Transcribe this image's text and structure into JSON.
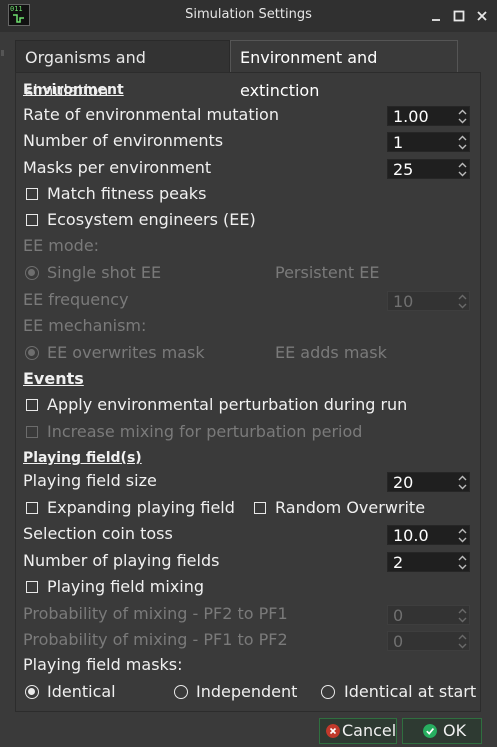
{
  "window": {
    "title": "Simulation Settings",
    "icon_text": "011"
  },
  "tabs": [
    {
      "label": "Organisms and simulation",
      "active": false
    },
    {
      "label": "Environment and extinction",
      "active": true
    }
  ],
  "environment": {
    "header": "Environment",
    "rate_label": "Rate of environmental mutation",
    "rate_value": "1.00",
    "num_env_label": "Number of environments",
    "num_env_value": "1",
    "masks_label": "Masks per environment",
    "masks_value": "25",
    "match_peaks_label": "Match fitness peaks",
    "match_peaks_checked": false,
    "ee_label": "Ecosystem engineers (EE)",
    "ee_checked": false,
    "ee_mode_label": "EE mode:",
    "ee_mode_options": [
      "Single shot EE",
      "Persistent EE"
    ],
    "ee_mode_selected": "Single shot EE",
    "ee_freq_label": "EE frequency",
    "ee_freq_value": "10",
    "ee_mech_label": "EE mechanism:",
    "ee_mech_options": [
      "EE overwrites mask",
      "EE adds mask"
    ],
    "ee_mech_selected": "EE overwrites mask"
  },
  "events": {
    "header": "Events",
    "perturb_label": "Apply environmental perturbation during run",
    "perturb_checked": false,
    "mixing_perturb_label": "Increase mixing for perturbation period",
    "mixing_perturb_checked": false
  },
  "playing_fields": {
    "header": "Playing field(s)",
    "size_label": "Playing field size",
    "size_value": "20",
    "expanding_label": "Expanding playing field",
    "expanding_checked": false,
    "random_overwrite_label": "Random Overwrite",
    "random_overwrite_checked": false,
    "coin_toss_label": "Selection coin toss",
    "coin_toss_value": "10.0",
    "num_fields_label": "Number of playing fields",
    "num_fields_value": "2",
    "mixing_label": "Playing field mixing",
    "mixing_checked": false,
    "prob_pf2_pf1_label": "Probability of mixing - PF2 to PF1",
    "prob_pf2_pf1_value": "0",
    "prob_pf1_pf2_label": "Probability of mixing - PF1 to PF2",
    "prob_pf1_pf2_value": "0",
    "masks_label": "Playing field masks:",
    "masks_options": [
      "Identical",
      "Independent",
      "Identical at start"
    ],
    "masks_selected": "Identical"
  },
  "buttons": {
    "cancel": "Cancel",
    "ok": "OK"
  },
  "colors": {
    "background": "#3a3a3a",
    "titlebar": "#303030",
    "spinbox": "#1f1f1f",
    "disabled_text": "#7a7a7a",
    "button_border": "#2f6f3f",
    "cancel_icon": "#c0392b",
    "ok_icon": "#27ae60"
  }
}
